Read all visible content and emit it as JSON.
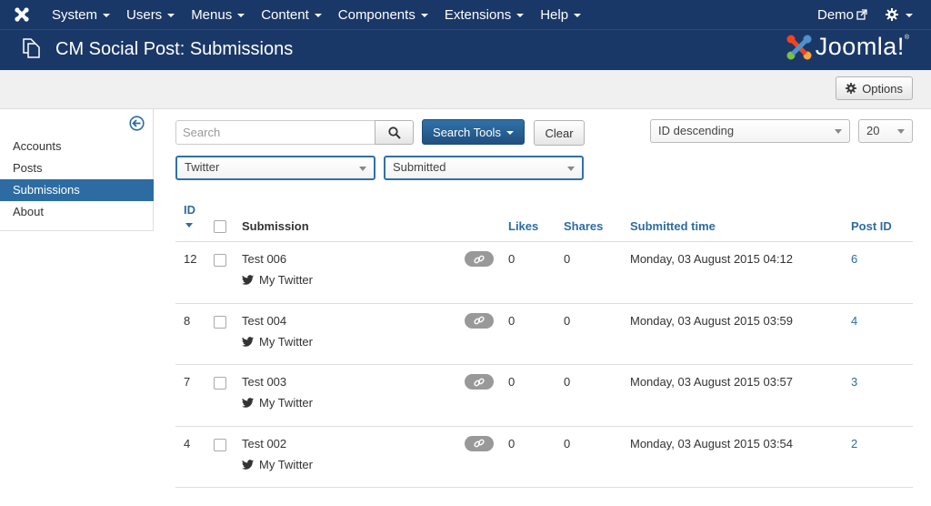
{
  "nav": {
    "items": [
      {
        "label": "System"
      },
      {
        "label": "Users"
      },
      {
        "label": "Menus"
      },
      {
        "label": "Content"
      },
      {
        "label": "Components"
      },
      {
        "label": "Extensions"
      },
      {
        "label": "Help"
      }
    ],
    "user": "Demo",
    "icons": {
      "logo": "joomla-icon",
      "external": "external-link-icon",
      "settings": "gear-icon"
    }
  },
  "header": {
    "title": "CM Social Post: Submissions",
    "brand": "Joomla!",
    "brand_reg": "®"
  },
  "toolbar": {
    "options_label": "Options"
  },
  "sidebar": {
    "items": [
      {
        "label": "Accounts",
        "active": false
      },
      {
        "label": "Posts",
        "active": false
      },
      {
        "label": "Submissions",
        "active": true
      },
      {
        "label": "About",
        "active": false
      }
    ]
  },
  "filters": {
    "search_placeholder": "Search",
    "search_tools_label": "Search Tools",
    "clear_label": "Clear",
    "ordering": "ID descending",
    "limit": "20",
    "account": "Twitter",
    "state": "Submitted"
  },
  "table": {
    "headers": {
      "id": "ID",
      "submission": "Submission",
      "likes": "Likes",
      "shares": "Shares",
      "submitted_time": "Submitted time",
      "post_id": "Post ID"
    },
    "rows": [
      {
        "id": "12",
        "title": "Test 006",
        "account": "My Twitter",
        "likes": "0",
        "shares": "0",
        "time": "Monday, 03 August 2015 04:12",
        "post_id": "6"
      },
      {
        "id": "8",
        "title": "Test 004",
        "account": "My Twitter",
        "likes": "0",
        "shares": "0",
        "time": "Monday, 03 August 2015 03:59",
        "post_id": "4"
      },
      {
        "id": "7",
        "title": "Test 003",
        "account": "My Twitter",
        "likes": "0",
        "shares": "0",
        "time": "Monday, 03 August 2015 03:57",
        "post_id": "3"
      },
      {
        "id": "4",
        "title": "Test 002",
        "account": "My Twitter",
        "likes": "0",
        "shares": "0",
        "time": "Monday, 03 August 2015 03:54",
        "post_id": "2"
      }
    ]
  },
  "colors": {
    "navbar": "#1a3867",
    "accent": "#2d6ca2",
    "active_item": "#2d6ca2"
  }
}
